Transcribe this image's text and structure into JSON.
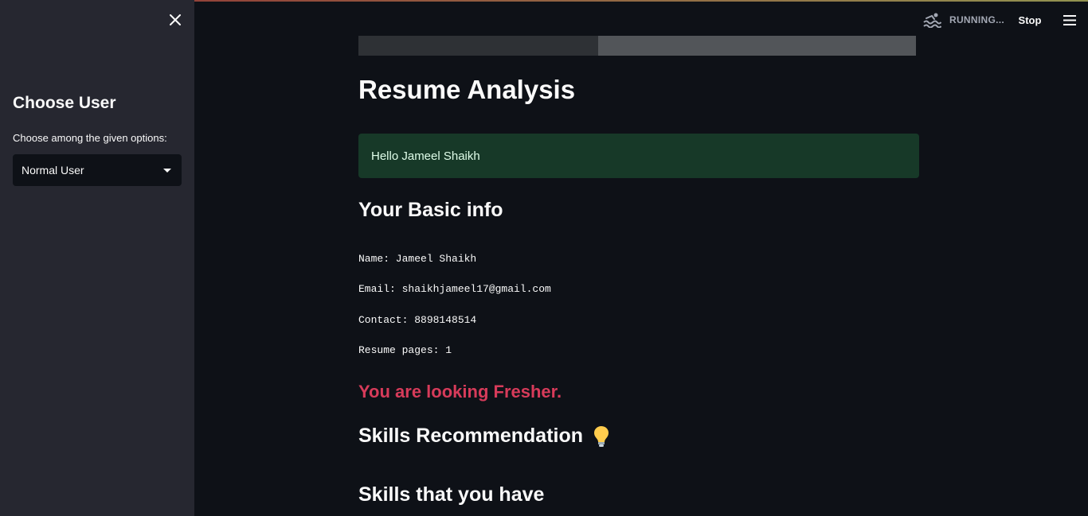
{
  "sidebar": {
    "title": "Choose User",
    "select_label": "Choose among the given options:",
    "select_value": "Normal User"
  },
  "header": {
    "status": "RUNNING...",
    "stop_label": "Stop"
  },
  "main": {
    "progress": 0.43,
    "title": "Resume Analysis",
    "greeting": "Hello Jameel Shaikh",
    "basic_info_heading": "Your Basic info",
    "name_line": "Name: Jameel Shaikh",
    "email_line": "Email: shaikhjameel17@gmail.com",
    "contact_line": "Contact: 8898148514",
    "pages_line": "Resume pages: 1",
    "level_message": "You are looking Fresher.",
    "skills_recommendation_heading": "Skills Recommendation",
    "skills_have_heading": "Skills that you have"
  },
  "icons": {
    "close": "close-icon",
    "running": "swimmer-icon",
    "menu": "hamburger-menu-icon",
    "bulb": "lightbulb-icon",
    "caret": "caret-down-icon"
  },
  "colors": {
    "background": "#0e1117",
    "sidebar": "#262730",
    "success_bg": "#173928",
    "fresher_text": "#d73b5a"
  }
}
